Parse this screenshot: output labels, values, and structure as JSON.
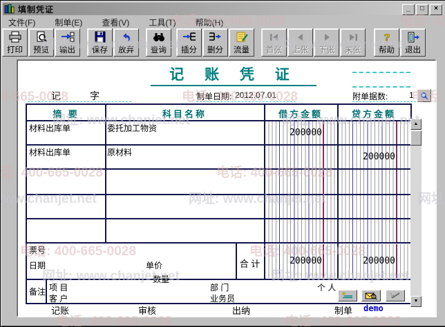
{
  "window": {
    "title": "填制凭证"
  },
  "icons": {
    "minimize": "_",
    "maximize": "□",
    "close": "×",
    "scroll_up": "▲",
    "scroll_down": "▼"
  },
  "menu": {
    "items": [
      {
        "label": "文件(F)"
      },
      {
        "label": "制单(E)"
      },
      {
        "label": "查看(V)"
      },
      {
        "label": "工具(T)"
      },
      {
        "label": "帮助(H)"
      }
    ]
  },
  "toolbar": {
    "buttons": [
      {
        "label": "打印"
      },
      {
        "label": "预览"
      },
      {
        "label": "输出"
      },
      {
        "label": "保存"
      },
      {
        "label": "放弃"
      },
      {
        "label": "查询"
      },
      {
        "label": "插分"
      },
      {
        "label": "删分"
      },
      {
        "label": "流量"
      },
      {
        "label": "首张"
      },
      {
        "label": "上张"
      },
      {
        "label": "下张"
      },
      {
        "label": "末张"
      },
      {
        "label": "帮助"
      },
      {
        "label": "退出"
      }
    ]
  },
  "voucher": {
    "title": "记 账 凭 证",
    "word_left": "记",
    "word_right": "字",
    "date_label": "制单日期:",
    "date_value": "2012.07.01",
    "attachments_label": "附单据数:",
    "attachments_value": "1",
    "table": {
      "headers": [
        "摘 要",
        "科目名称",
        "借方金额",
        "贷方金额"
      ],
      "rows": [
        {
          "summary": "材料出库单",
          "account": "委托加工物资",
          "debit": "200000",
          "credit": ""
        },
        {
          "summary": "材料出库单",
          "account": "原材料",
          "debit": "",
          "credit": "200000"
        }
      ],
      "footer": {
        "ticket": "票号",
        "date": "日期",
        "unit_price": "单价",
        "quantity": "数量"
      },
      "total_label": "合 计",
      "total_debit": "200000",
      "total_credit": "200000",
      "remark_label": "备注",
      "remark_fields": {
        "project": "项 目",
        "customer": "客 户",
        "department": "部 门",
        "salesman": "业务员",
        "person": "个 人"
      }
    },
    "signatures": {
      "bookkeeper_label": "记账",
      "auditor_label": "审核",
      "cashier_label": "出纳",
      "preparer_label": "制单",
      "preparer_value": "demo"
    }
  },
  "watermark": {
    "phone": "电话: 400-665-0028",
    "site": "网址: www.chanjet.net"
  },
  "colors": {
    "accent_teal": "#008080",
    "demo_blue": "#0000cc",
    "grid_blue": "#3a3a9e",
    "grid_red": "#cc2020"
  }
}
